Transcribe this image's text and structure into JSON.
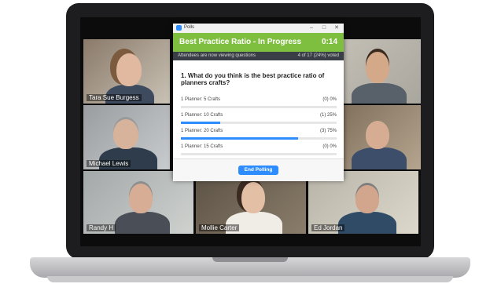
{
  "poll": {
    "window_title": "Polls",
    "title": "Best Practice Ratio - In Progress",
    "timer": "0:14",
    "status_left": "Attendees are now viewing questions",
    "status_right": "4 of 17 (24%) voted",
    "question": "1. What do you think is the best practice ratio of planners crafts?",
    "options": [
      {
        "label": "1 Planner: 5 Crafts",
        "percent": "(0) 0%",
        "fill": 0
      },
      {
        "label": "1 Planner: 10 Crafts",
        "percent": "(1) 25%",
        "fill": 0.25
      },
      {
        "label": "1 Planner: 20 Crafts",
        "percent": "(3) 75%",
        "fill": 0.75
      },
      {
        "label": "1 Planner: 15 Crafts",
        "percent": "(0) 0%",
        "fill": 0
      }
    ],
    "end_button": "End Polling",
    "accent_color": "#7fbf3f",
    "button_color": "#2d8cff"
  },
  "participants": [
    {
      "name": "Tara Sue Burgess"
    },
    {
      "name": ""
    },
    {
      "name": "Michael Lewis"
    },
    {
      "name": ""
    },
    {
      "name": "Randy H"
    },
    {
      "name": "Mollie Carter"
    },
    {
      "name": "Ed Jordan"
    }
  ]
}
